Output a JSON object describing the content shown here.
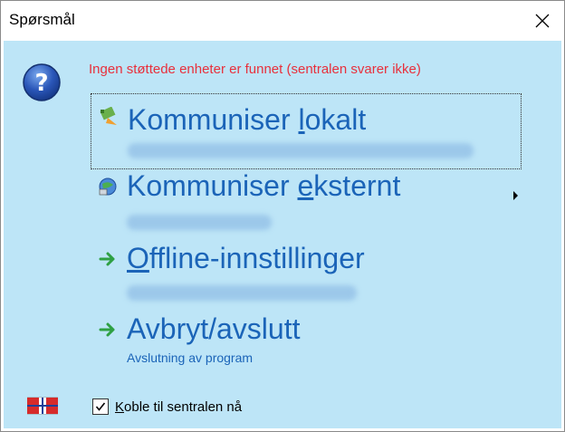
{
  "window": {
    "title": "Spørsmål"
  },
  "message": "Ingen støttede enheter er funnet (sentralen svarer ikke)",
  "commands": [
    {
      "label_pre": "Kommuniser ",
      "label_ul": "l",
      "label_post": "okalt",
      "subtitle": "",
      "icon": "network-computer-icon"
    },
    {
      "label_pre": "Kommuniser ",
      "label_ul": "e",
      "label_post": "ksternt",
      "subtitle": "",
      "icon": "globe-network-icon"
    },
    {
      "label_pre": "",
      "label_ul": "O",
      "label_post": "ffline-innstillinger",
      "subtitle": "",
      "icon": "green-arrow-icon"
    },
    {
      "label_pre": "Avbryt/avslutt",
      "label_ul": "",
      "label_post": "",
      "subtitle": "Avslutning av program",
      "icon": "green-arrow-icon"
    }
  ],
  "checkbox": {
    "label_ul": "K",
    "label_post": "oble til sentralen nå",
    "checked": true
  },
  "colors": {
    "panel": "#bde5f7",
    "command_text": "#1b64b8",
    "error_text": "#e8303c"
  }
}
